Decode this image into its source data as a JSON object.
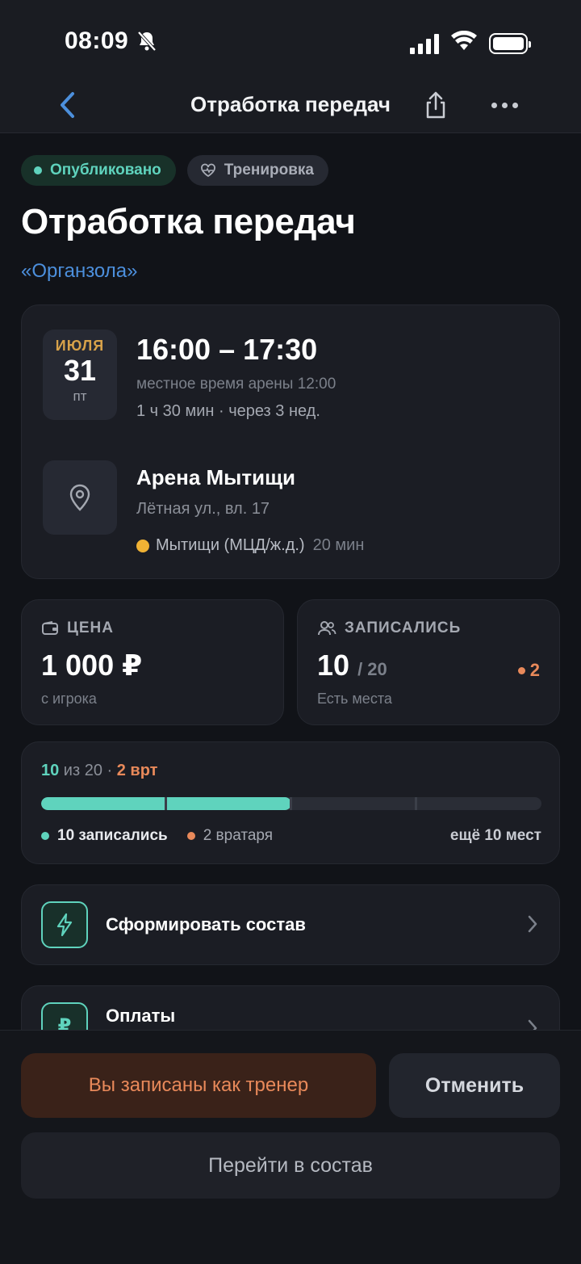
{
  "status_bar": {
    "time": "08:09",
    "icons": [
      "bell-slash-icon",
      "cellular-signal-icon",
      "wifi-icon",
      "battery-icon"
    ]
  },
  "nav": {
    "title": "Отработка передач",
    "back_icon": "chevron-left-icon",
    "share_icon": "share-icon",
    "more_icon": "more-horizontal-icon"
  },
  "chips": {
    "status": "Опубликовано",
    "type": "Тренировка",
    "type_icon": "heart-pulse-icon"
  },
  "event": {
    "title": "Отработка передач",
    "organizer": "«Органзола»"
  },
  "schedule": {
    "month": "ИЮЛЯ",
    "day": "31",
    "weekday": "пт",
    "time_range": "16:00 – 17:30",
    "local_time": "местное время арены 12:00",
    "duration": "1 ч 30 мин · через 3 нед."
  },
  "location": {
    "icon": "map-pin-icon",
    "arena": "Арена Мытищи",
    "address": "Лётная ул., вл. 17",
    "station": "Мытищи (МЦД/ж.д.)",
    "station_time": "20 мин",
    "station_color": "#f0b234"
  },
  "price": {
    "icon": "wallet-icon",
    "label": "ЦЕНА",
    "value": "1 000 ₽",
    "sub": "с игрока"
  },
  "joined": {
    "icon": "users-icon",
    "label": "ЗАПИСАЛИСЬ",
    "count": "10",
    "total": "/ 20",
    "sub": "Есть места",
    "goalies": "2"
  },
  "progress": {
    "count": "10",
    "of_total": " из 20 · ",
    "goalies_short": "2 врт",
    "fill_fraction": 0.5,
    "segments": 4,
    "legend_players": "10 записались",
    "legend_goalies": "2 вратаря",
    "remaining": "ещё 10 мест",
    "player_color": "#5fd3bd",
    "goalie_color": "#e8895a"
  },
  "actions": {
    "form_roster": "Сформировать состав",
    "form_roster_icon": "lightning-icon",
    "payments": "Оплаты",
    "payments_icon": "ruble-icon",
    "payments_icon_glyph": "₽"
  },
  "bottom": {
    "coach_status": "Вы записаны как тренер",
    "cancel": "Отменить",
    "go_roster": "Перейти в состав"
  },
  "colors": {
    "accent": "#5fd3bd",
    "link": "#4c8fdc",
    "warning": "#e8895a",
    "background": "#111318"
  }
}
